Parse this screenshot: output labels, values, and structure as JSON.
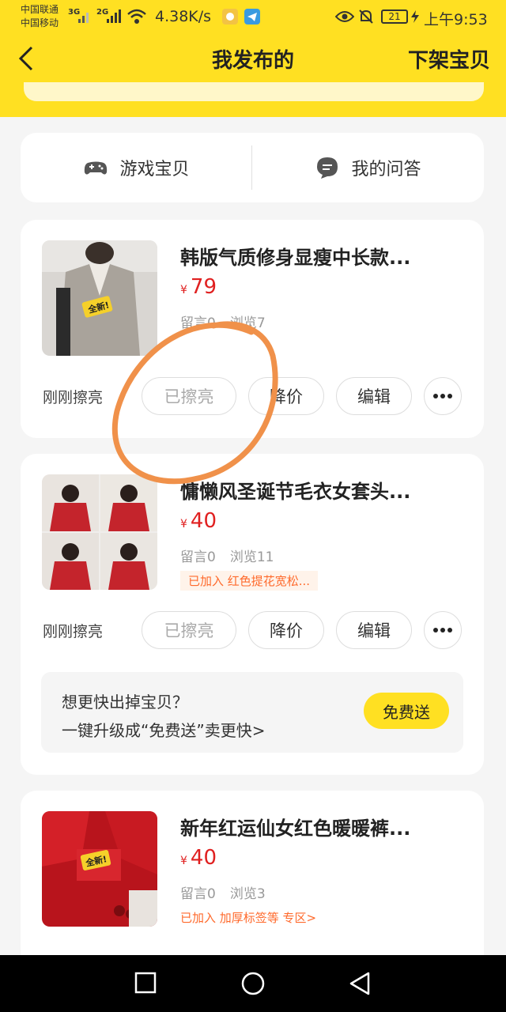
{
  "status_bar": {
    "carrier_1": "中国联通",
    "carrier_2": "中国移动",
    "net_1": "3G",
    "net_2": "2G",
    "speed": "4.38K/s",
    "battery": "21",
    "time": "上午9:53"
  },
  "navbar": {
    "title": "我发布的",
    "right_action": "下架宝贝"
  },
  "tabs": [
    {
      "label": "游戏宝贝",
      "icon": "gamepad-icon"
    },
    {
      "label": "我的问答",
      "icon": "chat-bubble-icon"
    }
  ],
  "items": [
    {
      "title": "韩版气质修身显瘦中长款...",
      "currency": "¥",
      "price": "79",
      "comments": "留言0",
      "views": "浏览7",
      "polish_status": "刚刚擦亮",
      "actions": {
        "polished": "已擦亮",
        "reduce": "降价",
        "edit": "编辑"
      }
    },
    {
      "title": "慵懒风圣诞节毛衣女套头...",
      "currency": "¥",
      "price": "40",
      "comments": "留言0",
      "views": "浏览11",
      "tag": "已加入 红色提花宽松...",
      "polish_status": "刚刚擦亮",
      "actions": {
        "polished": "已擦亮",
        "reduce": "降价",
        "edit": "编辑"
      },
      "promo": {
        "line1": "想更快出掉宝贝？",
        "line2": "一键升级成“免费送”卖更快>",
        "button": "免费送"
      }
    },
    {
      "title": "新年红运仙女红色暖暖裤...",
      "currency": "¥",
      "price": "40",
      "comments": "留言0",
      "views": "浏览3",
      "tag": "已加入 加厚标签等 专区>"
    }
  ],
  "colors": {
    "brand_yellow": "#ffe022",
    "price_red": "#e02020",
    "tag_orange": "#ff6a2c",
    "annotation_orange": "#f0914a"
  }
}
